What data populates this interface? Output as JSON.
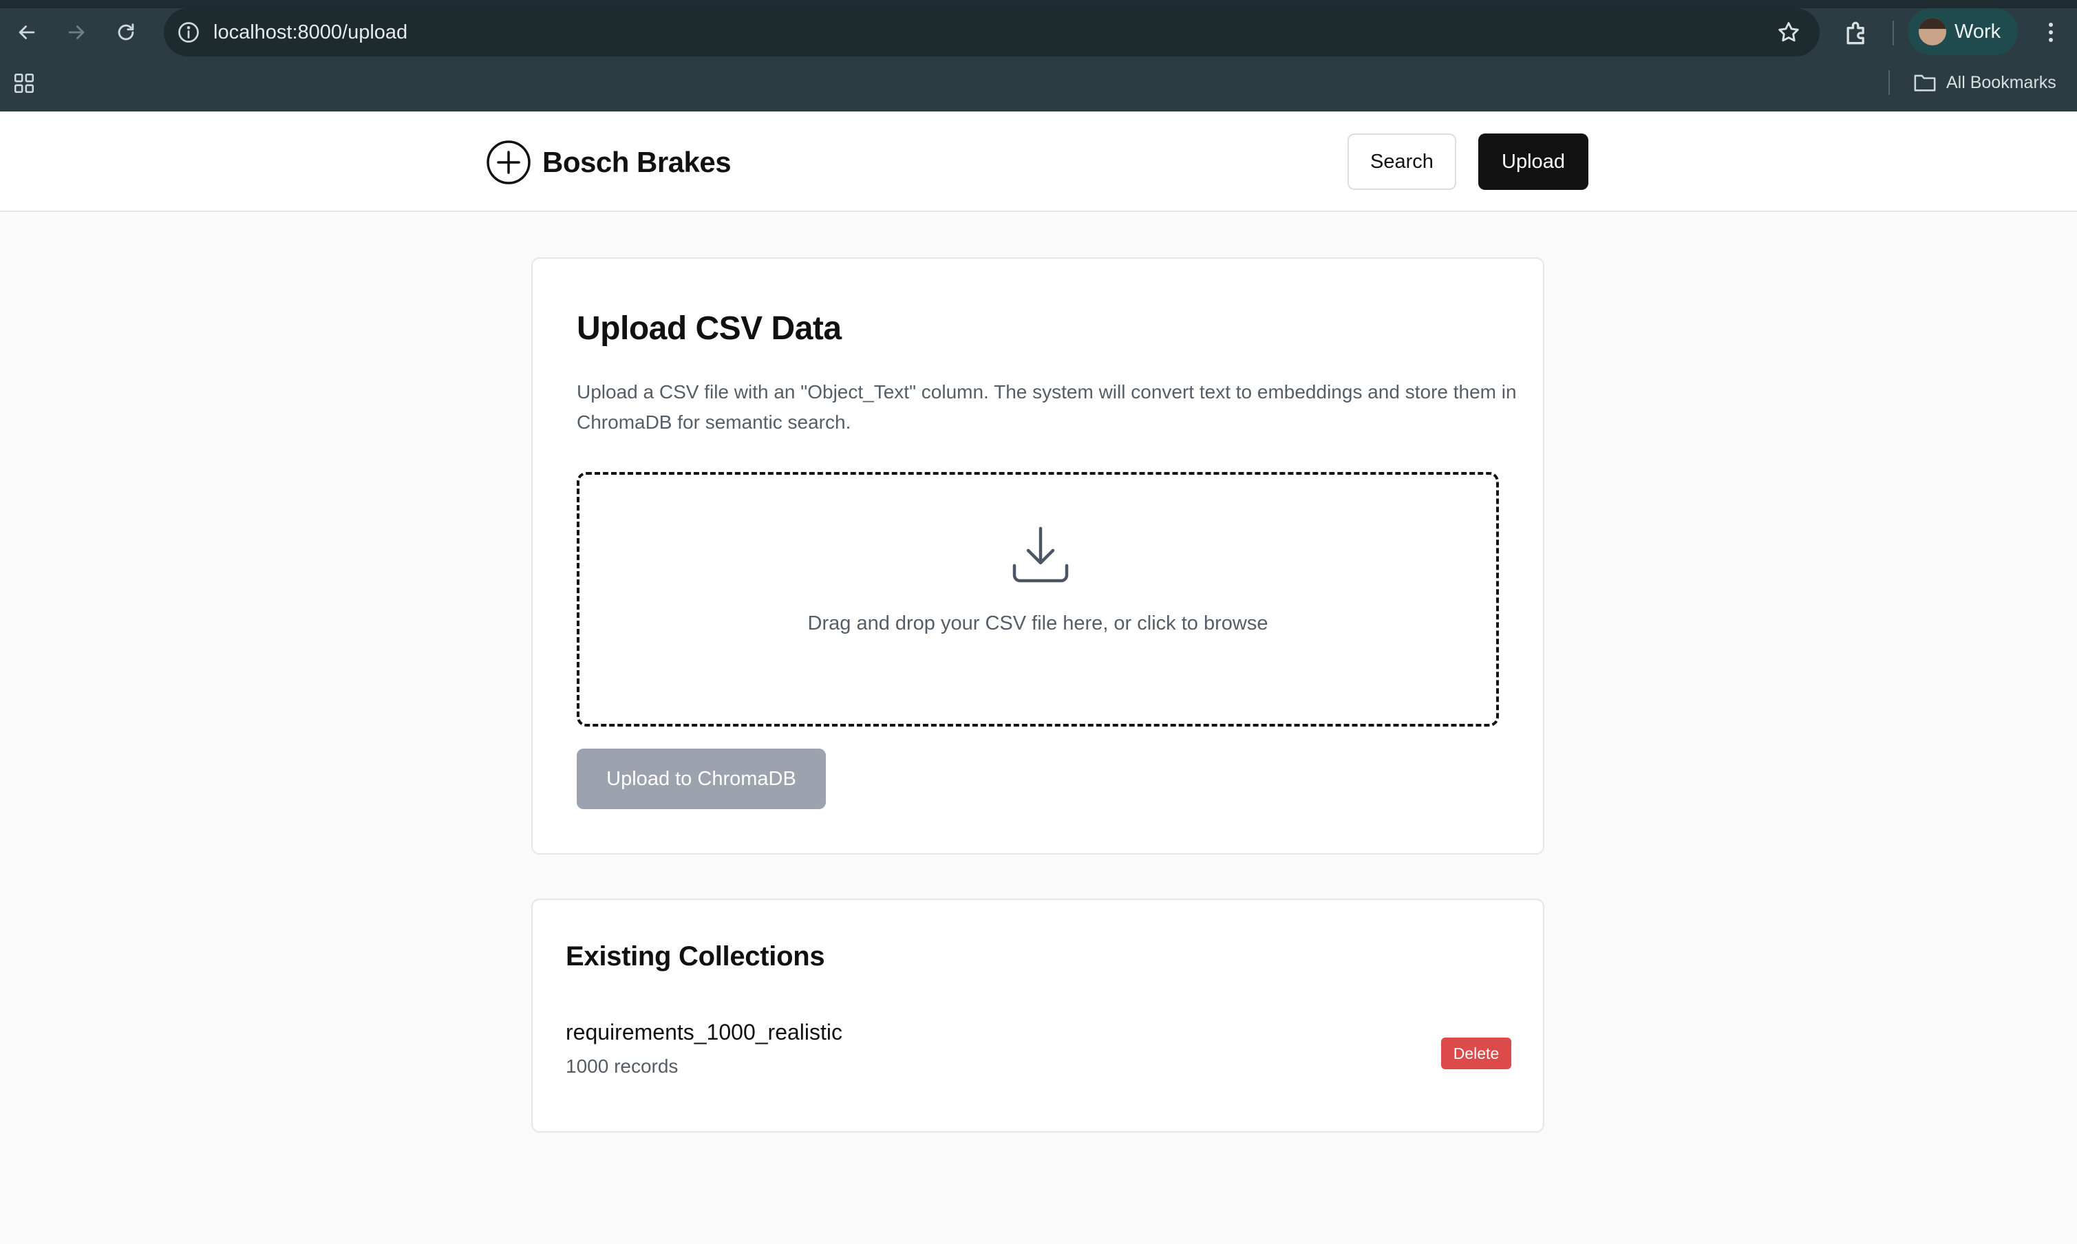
{
  "browser": {
    "url": "localhost:8000/upload",
    "profile_label": "Work",
    "bookmarks_label": "All Bookmarks"
  },
  "header": {
    "brand": "Bosch Brakes",
    "search_label": "Search",
    "upload_label": "Upload"
  },
  "upload_card": {
    "title": "Upload CSV Data",
    "description": "Upload a CSV file with an \"Object_Text\" column. The system will convert text to embeddings and store them in ChromaDB for semantic search.",
    "dropzone_text": "Drag and drop your CSV file here, or click to browse",
    "submit_label": "Upload to ChromaDB"
  },
  "collections_card": {
    "title": "Existing Collections",
    "items": [
      {
        "name": "requirements_1000_realistic",
        "count": "1000 records",
        "delete_label": "Delete"
      }
    ]
  },
  "colors": {
    "chrome_bg": "#2b3d43",
    "primary_button": "#121212",
    "disabled_button": "#9ca3af",
    "danger": "#dc4a4a"
  }
}
